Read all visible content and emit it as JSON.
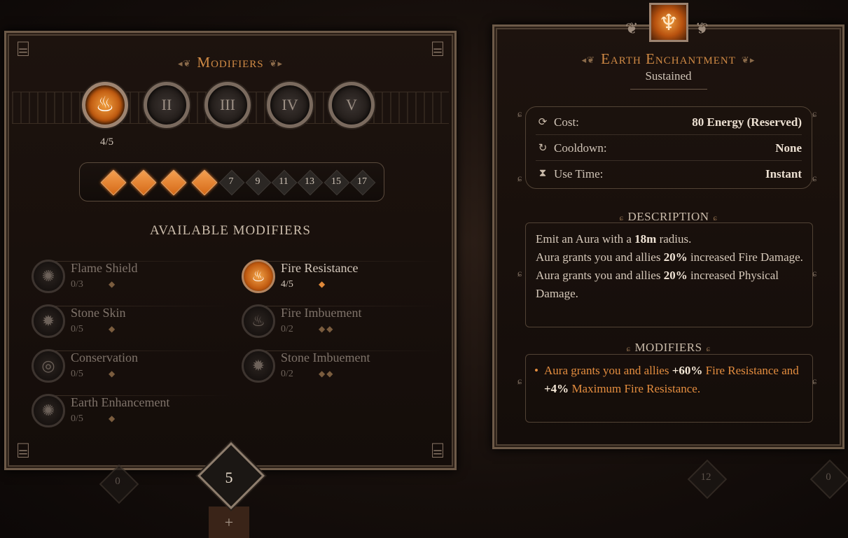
{
  "left_panel": {
    "title": "Modifiers",
    "tiers": [
      {
        "label": "",
        "active": true,
        "icon": "flame-icon"
      },
      {
        "label": "II",
        "active": false
      },
      {
        "label": "III",
        "active": false
      },
      {
        "label": "IV",
        "active": false
      },
      {
        "label": "V",
        "active": false
      }
    ],
    "tier_count": "4/5",
    "pips": [
      {
        "filled": true,
        "label": ""
      },
      {
        "filled": true,
        "label": ""
      },
      {
        "filled": true,
        "label": ""
      },
      {
        "filled": true,
        "label": ""
      },
      {
        "filled": false,
        "label": "7"
      },
      {
        "filled": false,
        "label": "9"
      },
      {
        "filled": false,
        "label": "11"
      },
      {
        "filled": false,
        "label": "13"
      },
      {
        "filled": false,
        "label": "15"
      },
      {
        "filled": false,
        "label": "17"
      }
    ],
    "available_title": "AVAILABLE MODIFIERS",
    "modifiers": [
      {
        "name": "Flame Shield",
        "progress": "0/3",
        "cost": "◆",
        "active": false
      },
      {
        "name": "Fire Resistance",
        "progress": "4/5",
        "cost": "◆",
        "active": true
      },
      {
        "name": "Stone Skin",
        "progress": "0/5",
        "cost": "◆",
        "active": false
      },
      {
        "name": "Fire Imbuement",
        "progress": "0/2",
        "cost": "◆◆",
        "active": false
      },
      {
        "name": "Conservation",
        "progress": "0/5",
        "cost": "◆",
        "active": false
      },
      {
        "name": "Stone Imbuement",
        "progress": "0/2",
        "cost": "◆◆",
        "active": false
      },
      {
        "name": "Earth Enhancement",
        "progress": "0/5",
        "cost": "◆",
        "active": false
      }
    ]
  },
  "bottom_tab": {
    "points": "5",
    "plus": "+"
  },
  "ghost_badges": {
    "left": "0",
    "right_1": "12",
    "right_2": "0"
  },
  "skill": {
    "title": "Earth Enchantment",
    "subtitle": "Sustained",
    "stats": [
      {
        "icon": "energy-icon",
        "glyph": "⟳",
        "label": "Cost:",
        "value": "80 Energy (Reserved)"
      },
      {
        "icon": "cooldown-icon",
        "glyph": "↻",
        "label": "Cooldown:",
        "value": "None"
      },
      {
        "icon": "hourglass-icon",
        "glyph": "⧗",
        "label": "Use Time:",
        "value": "Instant"
      }
    ],
    "description_heading": "DESCRIPTION",
    "description": {
      "l1_pre": "Emit an Aura with a ",
      "l1_bold": "18m",
      "l1_post": " radius.",
      "l2_pre": "Aura grants you and allies ",
      "l2_bold": "20%",
      "l2_post": " increased Fire Damage.",
      "l3_pre": "Aura grants you and allies ",
      "l3_bold": "20%",
      "l3_post": " increased Physical Damage."
    },
    "modifiers_heading": "MODIFIERS",
    "modifier_line": {
      "pre": "Aura grants you and allies ",
      "b1": "+60%",
      "mid": " Fire Resistance and ",
      "b2": "+4%",
      "post": " Maximum Fire Resistance."
    }
  },
  "colors": {
    "accent": "#d08a45",
    "orange_text": "#e48d3f",
    "border": "#6d5a48"
  }
}
